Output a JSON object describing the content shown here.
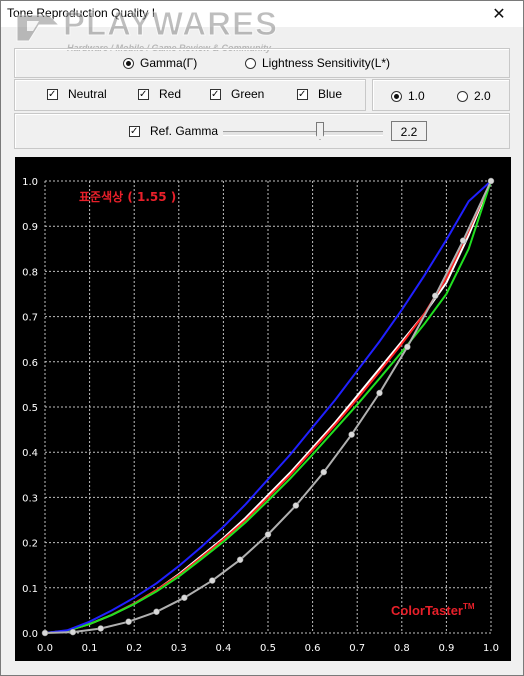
{
  "window": {
    "title": "Tone Reproduction Quality I",
    "close_glyph": "✕"
  },
  "watermark": {
    "brand": "PLAYWARES",
    "tagline": "Hardware / Mobile / Game Review & Community"
  },
  "mode": {
    "gamma_label": "Gamma(Γ)",
    "lightness_label": "Lightness Sensitivity(L*)",
    "selected": "gamma"
  },
  "channels": [
    {
      "label": "Neutral",
      "checked": true
    },
    {
      "label": "Red",
      "checked": true
    },
    {
      "label": "Green",
      "checked": true
    },
    {
      "label": "Blue",
      "checked": true
    }
  ],
  "scale": {
    "opt1": "1.0",
    "opt2": "2.0",
    "selected": "1.0"
  },
  "ref_gamma": {
    "label": "Ref. Gamma",
    "checked": true,
    "value": "2.2",
    "slider_fraction": 0.6
  },
  "chart_data": {
    "type": "line",
    "title": "표준색상 ( 1.55 )",
    "watermark_text": "ColorTaster",
    "watermark_sup": "TM",
    "xlim": [
      0.0,
      1.0
    ],
    "ylim": [
      0.0,
      1.0
    ],
    "x_ticks": [
      "0.0",
      "0.1",
      "0.2",
      "0.3",
      "0.4",
      "0.5",
      "0.6",
      "0.7",
      "0.8",
      "0.9",
      "1.0"
    ],
    "y_ticks": [
      "0.0",
      "0.1",
      "0.2",
      "0.3",
      "0.4",
      "0.5",
      "0.6",
      "0.7",
      "0.8",
      "0.9",
      "1.0"
    ],
    "grid": true,
    "background": "#000000",
    "series": [
      {
        "color": "#ffffff",
        "x": [
          0.0,
          0.05,
          0.1,
          0.15,
          0.2,
          0.25,
          0.3,
          0.35,
          0.4,
          0.45,
          0.5,
          0.55,
          0.6,
          0.65,
          0.7,
          0.75,
          0.8,
          0.85,
          0.9,
          0.95,
          1.0
        ],
        "y": [
          0.0,
          0.005,
          0.02,
          0.04,
          0.065,
          0.095,
          0.13,
          0.17,
          0.21,
          0.255,
          0.305,
          0.355,
          0.41,
          0.465,
          0.525,
          0.585,
          0.645,
          0.705,
          0.775,
          0.88,
          1.0
        ]
      },
      {
        "color": "#ff2020",
        "x": [
          0.0,
          0.05,
          0.1,
          0.15,
          0.2,
          0.25,
          0.3,
          0.35,
          0.4,
          0.45,
          0.5,
          0.55,
          0.6,
          0.65,
          0.7,
          0.75,
          0.8,
          0.85,
          0.9,
          0.95,
          1.0
        ],
        "y": [
          0.0,
          0.005,
          0.02,
          0.04,
          0.065,
          0.095,
          0.128,
          0.167,
          0.207,
          0.25,
          0.3,
          0.35,
          0.405,
          0.46,
          0.518,
          0.578,
          0.64,
          0.705,
          0.785,
          0.89,
          1.0
        ]
      },
      {
        "color": "#20e020",
        "x": [
          0.0,
          0.05,
          0.1,
          0.15,
          0.2,
          0.25,
          0.3,
          0.35,
          0.4,
          0.45,
          0.5,
          0.55,
          0.6,
          0.65,
          0.7,
          0.75,
          0.8,
          0.85,
          0.9,
          0.95,
          1.0
        ],
        "y": [
          0.0,
          0.005,
          0.02,
          0.04,
          0.064,
          0.092,
          0.125,
          0.163,
          0.202,
          0.245,
          0.293,
          0.342,
          0.395,
          0.45,
          0.505,
          0.563,
          0.622,
          0.683,
          0.75,
          0.85,
          1.0
        ]
      },
      {
        "color": "#2020ff",
        "x": [
          0.0,
          0.05,
          0.1,
          0.15,
          0.2,
          0.25,
          0.3,
          0.35,
          0.4,
          0.45,
          0.5,
          0.55,
          0.6,
          0.65,
          0.7,
          0.75,
          0.8,
          0.85,
          0.9,
          0.95,
          1.0
        ],
        "y": [
          0.0,
          0.006,
          0.025,
          0.05,
          0.078,
          0.11,
          0.148,
          0.19,
          0.235,
          0.285,
          0.34,
          0.395,
          0.455,
          0.515,
          0.58,
          0.645,
          0.715,
          0.79,
          0.87,
          0.955,
          1.0
        ]
      },
      {
        "color": "#b0b0b0",
        "markers": true,
        "x": [
          0.0,
          0.0625,
          0.125,
          0.1875,
          0.25,
          0.3125,
          0.375,
          0.4375,
          0.5,
          0.5625,
          0.625,
          0.6875,
          0.75,
          0.8125,
          0.875,
          0.9375,
          1.0
        ],
        "y": [
          0.0,
          0.002,
          0.01,
          0.025,
          0.047,
          0.078,
          0.116,
          0.162,
          0.218,
          0.282,
          0.356,
          0.439,
          0.531,
          0.633,
          0.746,
          0.868,
          1.0
        ]
      }
    ]
  }
}
